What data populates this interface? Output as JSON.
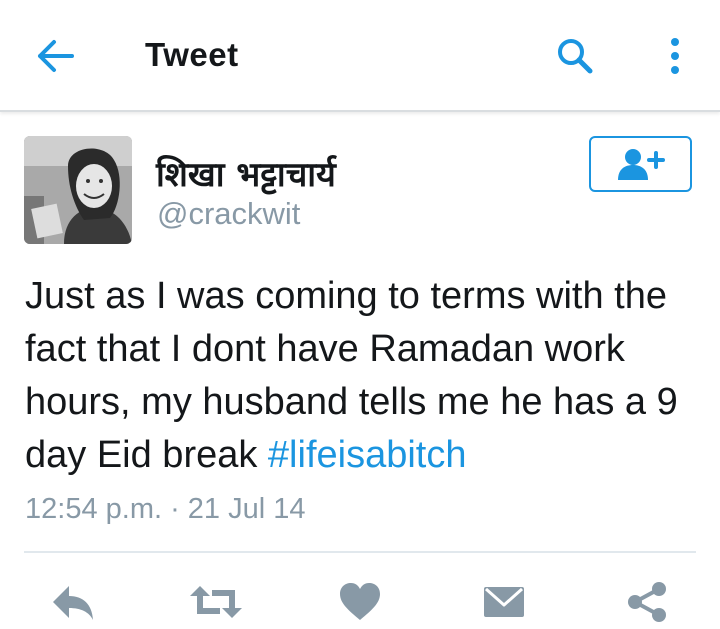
{
  "header": {
    "title": "Tweet",
    "back_icon": "arrow-left-icon",
    "search_icon": "search-icon",
    "more_icon": "more-vertical-icon"
  },
  "author": {
    "display_name": "शिखा भट्टाचार्य",
    "handle": "@crackwit",
    "avatar_icon": "avatar-photo"
  },
  "follow_button": {
    "icon": "follow-user-icon"
  },
  "tweet": {
    "text": "Just as I was coming to terms with the fact that I dont have Ramadan work hours, my husband tells me he has a 9 day Eid break ",
    "hashtag": "#lifeisabitch",
    "timestamp": "12:54 p.m. · 21 Jul 14"
  },
  "actions": [
    {
      "name": "reply",
      "icon": "reply-icon"
    },
    {
      "name": "retweet",
      "icon": "retweet-icon"
    },
    {
      "name": "like",
      "icon": "heart-icon"
    },
    {
      "name": "direct-message",
      "icon": "envelope-icon"
    },
    {
      "name": "share",
      "icon": "share-icon"
    }
  ],
  "colors": {
    "accent": "#1b95e0",
    "icon_gray": "#8899a6",
    "text": "#14171a",
    "secondary_text": "#8899a6"
  }
}
